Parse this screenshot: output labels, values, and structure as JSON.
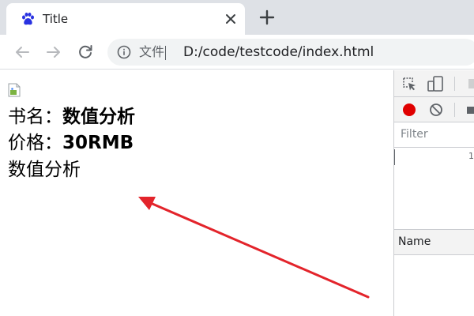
{
  "tab": {
    "title": "Title",
    "favicon": "baidu-paw-icon",
    "close_icon": "close-icon"
  },
  "new_tab_icon": "plus-icon",
  "toolbar": {
    "back_icon": "back-arrow-icon",
    "forward_icon": "forward-arrow-icon",
    "reload_icon": "reload-icon",
    "scheme_label": "文件",
    "url": "D:/code/testcode/index.html"
  },
  "page": {
    "book_label": "书名：",
    "book_value": "数值分析",
    "price_label": "价格：",
    "price_value": "30RMB",
    "plain_text": "数值分析",
    "arrow_color": "#e3242b"
  },
  "devtools": {
    "filter_placeholder": "Filter",
    "timeline_tick": "1",
    "column_name": "Name",
    "record_color": "#e00000"
  }
}
